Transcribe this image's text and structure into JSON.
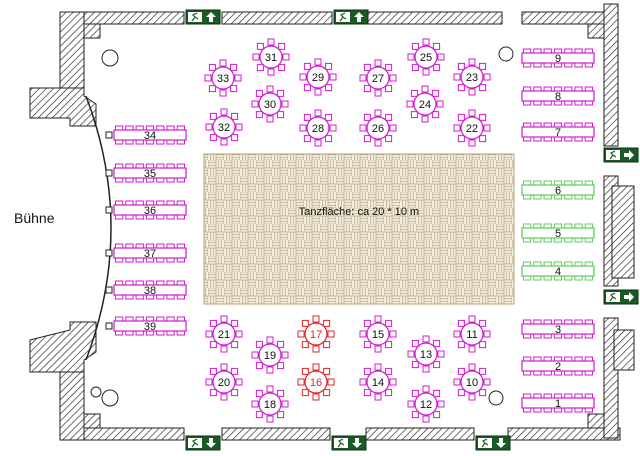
{
  "stage": {
    "label": "Bühne"
  },
  "dance_floor": {
    "label": "Tanzfläche: ca 20 * 10 m"
  },
  "colors": {
    "standard": "#d21ad2",
    "reserved": "#e3252a",
    "green_tables": "#5ccc5c",
    "floor_fill": "#f3efe2",
    "floor_line": "#b9a27a",
    "wall": "#222222",
    "exit_sign": "#1c5a24"
  },
  "icons": [
    "emergency-exit-icon",
    "arrow-up-icon",
    "arrow-down-icon",
    "arrow-right-icon"
  ],
  "round_tables": [
    {
      "label": "31"
    },
    {
      "label": "33"
    },
    {
      "label": "30"
    },
    {
      "label": "32"
    },
    {
      "label": "29"
    },
    {
      "label": "28"
    },
    {
      "label": "27"
    },
    {
      "label": "26"
    },
    {
      "label": "25"
    },
    {
      "label": "24"
    },
    {
      "label": "23"
    },
    {
      "label": "22"
    },
    {
      "label": "21"
    },
    {
      "label": "20"
    },
    {
      "label": "19"
    },
    {
      "label": "18"
    },
    {
      "label": "17",
      "status": "reserved"
    },
    {
      "label": "16",
      "status": "reserved"
    },
    {
      "label": "15"
    },
    {
      "label": "14"
    },
    {
      "label": "13"
    },
    {
      "label": "12"
    },
    {
      "label": "11"
    },
    {
      "label": "10"
    }
  ],
  "left_long_tables": [
    {
      "label": "34"
    },
    {
      "label": "35"
    },
    {
      "label": "36"
    },
    {
      "label": "37"
    },
    {
      "label": "38"
    },
    {
      "label": "39"
    }
  ],
  "right_long_tables": [
    {
      "label": "9"
    },
    {
      "label": "8"
    },
    {
      "label": "7"
    },
    {
      "label": "6",
      "status": "green"
    },
    {
      "label": "5",
      "status": "green"
    },
    {
      "label": "4",
      "status": "green"
    },
    {
      "label": "3"
    },
    {
      "label": "2"
    },
    {
      "label": "1"
    }
  ]
}
